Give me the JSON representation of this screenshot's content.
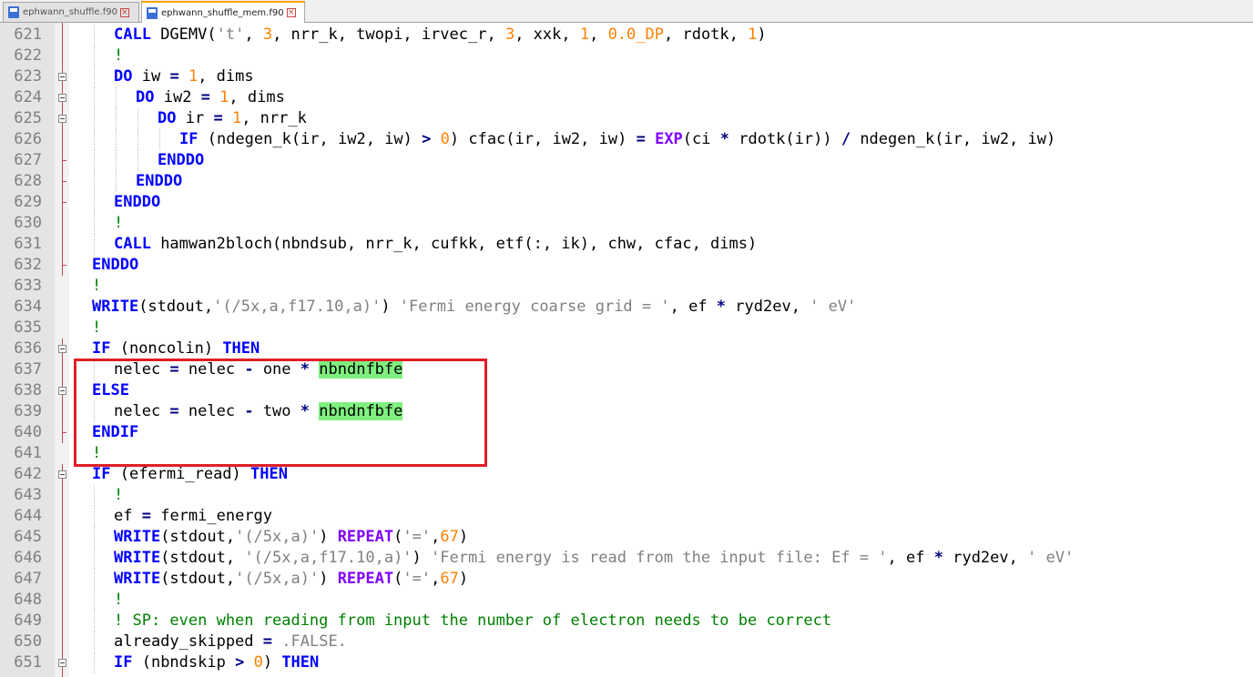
{
  "tabs": [
    {
      "label": "ephwann_shuffle.f90",
      "close": "×",
      "active": false,
      "icon": "file-icon"
    },
    {
      "label": "ephwann_shuffle_mem.f90",
      "close": "×",
      "active": true,
      "icon": "file-icon"
    }
  ],
  "colors": {
    "keyword": "#0000ff",
    "intrinsic": "#8000ff",
    "number": "#ff8000",
    "string": "#808080",
    "comment": "#008000",
    "highlight": "#7ff07f",
    "annotation_box": "#e01e28"
  },
  "editor": {
    "lines": [
      {
        "n": "621",
        "text": "CALL DGEMV('t', 3, nrr_k, twopi, irvec_r, 3, xxk, 1, 0.0_DP, rdotk, 1)"
      },
      {
        "n": "622",
        "text": "!"
      },
      {
        "n": "623",
        "text": "DO iw = 1, dims"
      },
      {
        "n": "624",
        "text": "DO iw2 = 1, dims"
      },
      {
        "n": "625",
        "text": "DO ir = 1, nrr_k"
      },
      {
        "n": "626",
        "text": "IF (ndegen_k(ir, iw2, iw) > 0) cfac(ir, iw2, iw) = EXP(ci * rdotk(ir)) / ndegen_k(ir, iw2, iw)"
      },
      {
        "n": "627",
        "text": "ENDDO"
      },
      {
        "n": "628",
        "text": "ENDDO"
      },
      {
        "n": "629",
        "text": "ENDDO"
      },
      {
        "n": "630",
        "text": "!"
      },
      {
        "n": "631",
        "text": "CALL hamwan2bloch(nbndsub, nrr_k, cufkk, etf(:, ik), chw, cfac, dims)"
      },
      {
        "n": "632",
        "text": "ENDDO"
      },
      {
        "n": "633",
        "text": "!"
      },
      {
        "n": "634",
        "text": "WRITE(stdout,'(/5x,a,f17.10,a)') 'Fermi energy coarse grid = ', ef * ryd2ev, ' eV'"
      },
      {
        "n": "635",
        "text": "!"
      },
      {
        "n": "636",
        "text": "IF (noncolin) THEN"
      },
      {
        "n": "637",
        "text": "nelec = nelec - one * nbndnfbfe"
      },
      {
        "n": "638",
        "text": "ELSE"
      },
      {
        "n": "639",
        "text": "nelec = nelec - two * nbndnfbfe"
      },
      {
        "n": "640",
        "text": "ENDIF"
      },
      {
        "n": "641",
        "text": "!"
      },
      {
        "n": "642",
        "text": "IF (efermi_read) THEN"
      },
      {
        "n": "643",
        "text": "!"
      },
      {
        "n": "644",
        "text": "ef = fermi_energy"
      },
      {
        "n": "645",
        "text": "WRITE(stdout,'(/5x,a)') REPEAT('=',67)"
      },
      {
        "n": "646",
        "text": "WRITE(stdout, '(/5x,a,f17.10,a)') 'Fermi energy is read from the input file: Ef = ', ef * ryd2ev, ' eV'"
      },
      {
        "n": "647",
        "text": "WRITE(stdout,'(/5x,a)') REPEAT('=',67)"
      },
      {
        "n": "648",
        "text": "!"
      },
      {
        "n": "649",
        "text": "! SP: even when reading from input the number of electron needs to be correct"
      },
      {
        "n": "650",
        "text": "already_skipped = .FALSE."
      },
      {
        "n": "651",
        "text": "IF (nbndskip > 0) THEN"
      }
    ]
  }
}
